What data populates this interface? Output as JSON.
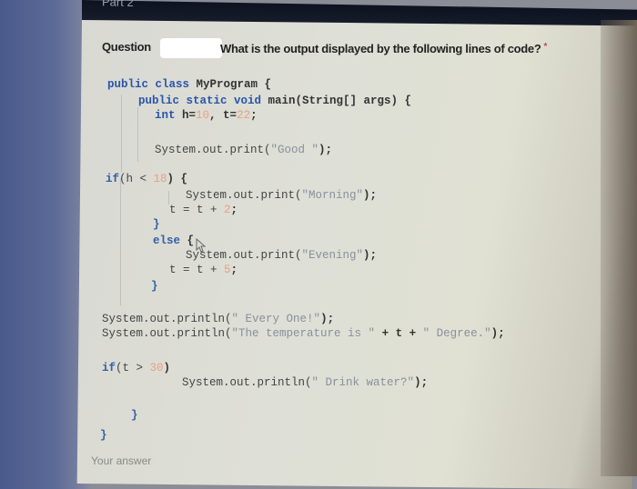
{
  "window": {
    "tab_label": "Part 2"
  },
  "question": {
    "label": "Question",
    "redacted_number": "",
    "text": "What is the output displayed by the following lines of code?",
    "required_marker": "*"
  },
  "code_lines": {
    "l1": {
      "kw": "public class",
      "rest": " MyProgram {"
    },
    "l2": {
      "kw": "public static void",
      "rest": " main(String[] args) {"
    },
    "l3": {
      "kw": "int",
      "a": " h=",
      "n1": "10",
      "b": ", t=",
      "n2": "22",
      "c": ";"
    },
    "l4": {
      "a": "System.out.print(",
      "s": "\"Good \"",
      "b": ");"
    },
    "l5": {
      "kw": "if",
      "a": "(h < ",
      "n": "18",
      "b": ") {"
    },
    "l6": {
      "a": "System.out.print(",
      "s": "\"Morning\"",
      "b": ");"
    },
    "l7": {
      "a": "t = t + ",
      "n": "2",
      "b": ";"
    },
    "l8": {
      "a": "}"
    },
    "l9": {
      "kw": "else",
      "b": " {"
    },
    "l10": {
      "a": "System.out.print(",
      "s": "\"Evening\"",
      "b": ");"
    },
    "l11": {
      "a": "t = t + ",
      "n": "5",
      "b": ";"
    },
    "l12": {
      "a": "}"
    },
    "l13": {
      "a": "System.out.println(",
      "s": "\" Every One!\"",
      "b": ");"
    },
    "l14": {
      "a": "System.out.println(",
      "s1": "\"The temperature is \"",
      "m": " + t + ",
      "s2": "\" Degree.\"",
      "b": ");"
    },
    "l15": {
      "kw": "if",
      "a": "(t > ",
      "n": "30",
      "b": ")"
    },
    "l16": {
      "a": "System.out.println(",
      "s": "\" Drink water?\"",
      "b": ");"
    },
    "l17": {
      "a": "}"
    },
    "l18": {
      "a": "}"
    }
  },
  "answer": {
    "placeholder": "Your answer"
  }
}
